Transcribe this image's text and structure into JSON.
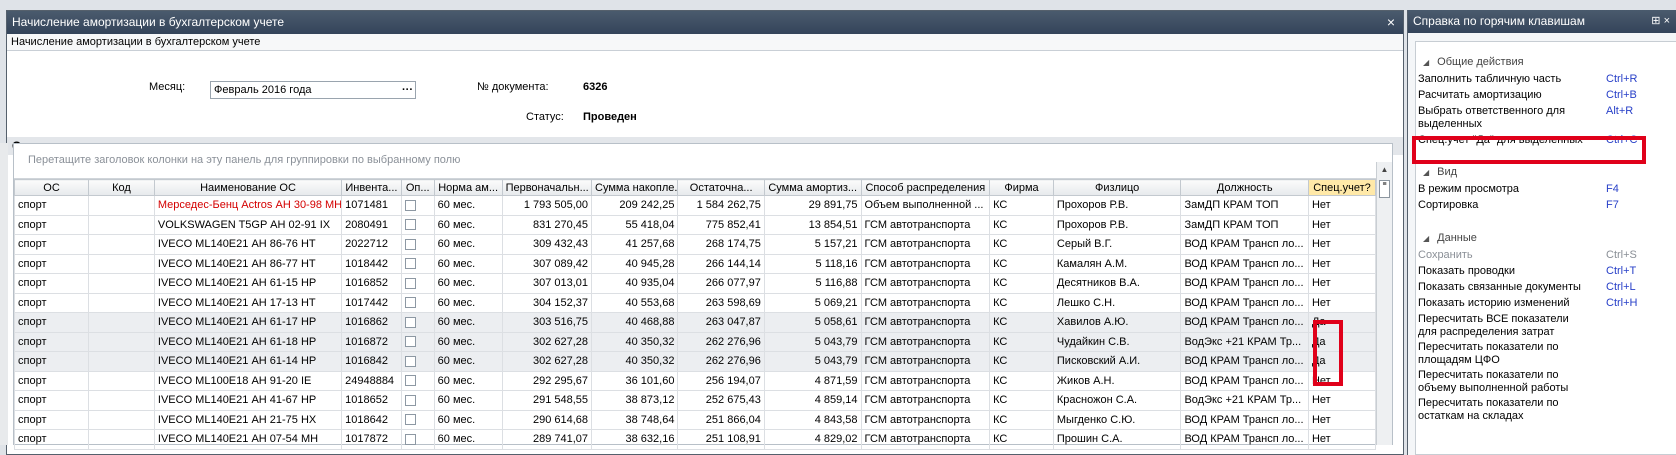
{
  "main_window": {
    "title": "Начисление амортизации в бухгалтерском учете",
    "subtitle": "Начисление амортизации в бухгалтерском учете",
    "close_icon": "×"
  },
  "form": {
    "month_label": "Месяц:",
    "month_value": "Февраль 2016 года",
    "month_button": "···",
    "doc_number_label": "№ документа:",
    "doc_number": "6326",
    "status_label": "Статус:",
    "status_value": "Проведен"
  },
  "section_title": "Основные средства",
  "grid": {
    "group_panel_hint": "Перетащите заголовок колонки на эту панель для группировки по выбранному полю",
    "columns": [
      "ОС",
      "Код",
      "Наименование ОС",
      "Инвента...",
      "Оп...",
      "Норма ам...",
      "Первоначальн...",
      "Сумма накопле...",
      "Остаточна...",
      "Сумма амортиз...",
      "Способ распределения",
      "Фирма",
      "Физлицо",
      "Должность",
      "Спец.учет?"
    ],
    "rows": [
      [
        "спорт",
        "",
        "Мерседес-Бенц Actros АН 30-98 МН",
        "1071481",
        "",
        "60 мес.",
        "1 793 505,00",
        "209 242,25",
        "1 584 262,75",
        "29 891,75",
        "Объем выполненной ...",
        "КС",
        "Прохоров Р.В.",
        "ЗамДП КРАМ ТОП",
        "Нет"
      ],
      [
        "спорт",
        "",
        "VOLKSWAGEN T5GP АН 02-91 IX",
        "2080491",
        "",
        "60 мес.",
        "831 270,45",
        "55 418,04",
        "775 852,41",
        "13 854,51",
        "ГСМ автотранспорта",
        "КС",
        "Прохоров Р.В.",
        "ЗамДП КРАМ ТОП",
        "Нет"
      ],
      [
        "спорт",
        "",
        "IVECO ML140E21 АН 86-76 НТ",
        "2022712",
        "",
        "60 мес.",
        "309 432,43",
        "41 257,68",
        "268 174,75",
        "5 157,21",
        "ГСМ автотранспорта",
        "КС",
        "Серый В.Г.",
        "ВОД КРАМ Трансп ло...",
        "Нет"
      ],
      [
        "спорт",
        "",
        "IVECO ML140E21 АН 86-77 НТ",
        "1018442",
        "",
        "60 мес.",
        "307 089,42",
        "40 945,28",
        "266 144,14",
        "5 118,16",
        "ГСМ автотранспорта",
        "КС",
        "Камалян А.М.",
        "ВОД КРАМ Трансп ло...",
        "Нет"
      ],
      [
        "спорт",
        "",
        "IVECO ML140E21 АН 61-15 НР",
        "1016852",
        "",
        "60 мес.",
        "307 013,01",
        "40 935,04",
        "266 077,97",
        "5 116,88",
        "ГСМ автотранспорта",
        "КС",
        "Десятников В.А.",
        "ВОД КРАМ Трансп ло...",
        "Нет"
      ],
      [
        "спорт",
        "",
        "IVECO ML140E21 АН 17-13 НТ",
        "1017442",
        "",
        "60 мес.",
        "304 152,37",
        "40 553,68",
        "263 598,69",
        "5 069,21",
        "ГСМ автотранспорта",
        "КС",
        "Лешко С.Н.",
        "ВОД КРАМ Трансп ло...",
        "Нет"
      ],
      [
        "спорт",
        "",
        "IVECO ML140E21 АН 61-17 НР",
        "1016862",
        "",
        "60 мес.",
        "303 516,75",
        "40 468,88",
        "263 047,87",
        "5 058,61",
        "ГСМ автотранспорта",
        "КС",
        "Хавилов А.Ю.",
        "ВОД КРАМ Трансп ло...",
        "Да"
      ],
      [
        "спорт",
        "",
        "IVECO ML140E21 АН 61-18 НР",
        "1016872",
        "",
        "60 мес.",
        "302 627,28",
        "40 350,32",
        "262 276,96",
        "5 043,79",
        "ГСМ автотранспорта",
        "КС",
        "Чудайкин С.В.",
        "ВодЭкс +21 КРАМ Тр...",
        "Да"
      ],
      [
        "спорт",
        "",
        "IVECO ML140E21 АН 61-14 НР",
        "1016842",
        "",
        "60 мес.",
        "302 627,28",
        "40 350,32",
        "262 276,96",
        "5 043,79",
        "ГСМ автотранспорта",
        "КС",
        "Писковский А.И.",
        "ВОД КРАМ Трансп ло...",
        "Да"
      ],
      [
        "спорт",
        "",
        "IVECO ML100E18 АН 91-20 IE",
        "24948884",
        "",
        "60 мес.",
        "292 295,67",
        "36 101,60",
        "256 194,07",
        "4 871,59",
        "ГСМ автотранспорта",
        "КС",
        "Жиков А.Н.",
        "ВОД КРАМ Трансп ло...",
        "Нет"
      ],
      [
        "спорт",
        "",
        "IVECO ML140E21 АН 41-67 НР",
        "1018652",
        "",
        "60 мес.",
        "291 548,55",
        "38 873,12",
        "252 675,43",
        "4 859,14",
        "ГСМ автотранспорта",
        "КС",
        "Красножон С.А.",
        "ВодЭкс +21 КРАМ Тр...",
        "Нет"
      ],
      [
        "спорт",
        "",
        "IVECO ML140E21 АН 21-75 НХ",
        "1018642",
        "",
        "60 мес.",
        "290 614,68",
        "38 748,64",
        "251 866,04",
        "4 843,58",
        "ГСМ автотранспорта",
        "КС",
        "Мыгденко С.Ю.",
        "ВОД КРАМ Трансп ло...",
        "Нет"
      ],
      [
        "спорт",
        "",
        "IVECO ML140E21 АН 07-54 МН",
        "1017872",
        "",
        "60 мес.",
        "289 741,07",
        "38 632,16",
        "251 108,91",
        "4 829,02",
        "ГСМ автотранспорта",
        "КС",
        "Прошин С.А.",
        "ВОД КРАМ Трансп ло...",
        "Нет"
      ]
    ]
  },
  "help_panel": {
    "title": "Справка по горячим клавишам",
    "icons": "⊞ ×",
    "groups": [
      {
        "title": "Общие действия",
        "items": [
          {
            "action": "Заполнить табличную часть",
            "key": "Ctrl+R"
          },
          {
            "action": "Расчитать амортизацию",
            "key": "Ctrl+B"
          },
          {
            "action": "Выбрать ответственного для выделенных",
            "key": "Alt+R"
          },
          {
            "action": "Спец.учет \"Да\" для выделенных",
            "key": "Ctrl+C"
          }
        ]
      },
      {
        "title": "Вид",
        "items": [
          {
            "action": "В режим просмотра",
            "key": "F4"
          },
          {
            "action": "Сортировка",
            "key": "F7"
          }
        ]
      },
      {
        "title": "Данные",
        "items": [
          {
            "action": "Сохранить",
            "key": "Ctrl+S"
          },
          {
            "action": "Показать проводки",
            "key": "Ctrl+T"
          },
          {
            "action": "Показать связанные документы",
            "key": "Ctrl+L"
          },
          {
            "action": "Показать историю изменений",
            "key": "Ctrl+H"
          },
          {
            "action": "Пересчитать ВСЕ показатели для распределения затрат",
            "key": ""
          },
          {
            "action": "Пересчитать показатели по площадям ЦФО",
            "key": ""
          },
          {
            "action": "Пересчитать показатели по объему выполненной работы",
            "key": ""
          },
          {
            "action": "Пересчитать показатели по остаткам на складах",
            "key": ""
          }
        ]
      }
    ]
  }
}
